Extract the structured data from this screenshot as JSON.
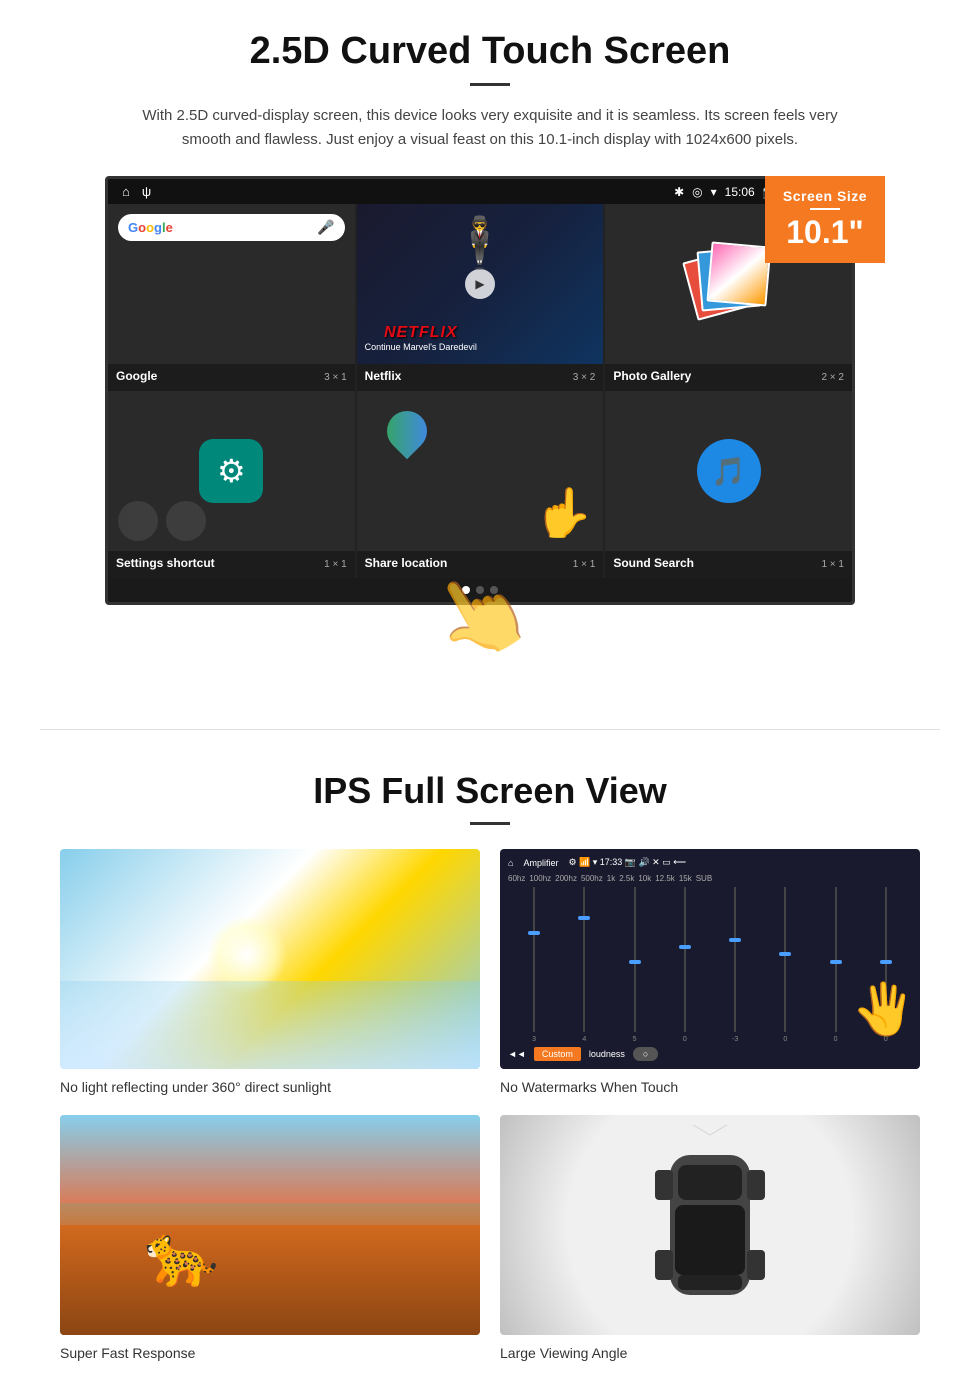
{
  "section1": {
    "title": "2.5D Curved Touch Screen",
    "description": "With 2.5D curved-display screen, this device looks very exquisite and it is seamless. Its screen feels very smooth and flawless. Just enjoy a visual feast on this 10.1-inch display with 1024x600 pixels.",
    "screen_badge": {
      "title": "Screen Size",
      "size": "10.1\""
    },
    "status_bar": {
      "time": "15:06"
    },
    "apps": {
      "row1": [
        {
          "name": "Google",
          "size": "3 × 1"
        },
        {
          "name": "Netflix",
          "size": "3 × 2"
        },
        {
          "name": "Photo Gallery",
          "size": "2 × 2"
        }
      ],
      "row2": [
        {
          "name": "Settings shortcut",
          "size": "1 × 1"
        },
        {
          "name": "Share location",
          "size": "1 × 1"
        },
        {
          "name": "Sound Search",
          "size": "1 × 1"
        }
      ]
    },
    "netflix_text": "NETFLIX",
    "netflix_subtitle": "Continue Marvel's Daredevil"
  },
  "section2": {
    "title": "IPS Full Screen View",
    "features": [
      {
        "id": "sunlight",
        "caption": "No light reflecting under 360° direct sunlight"
      },
      {
        "id": "equalizer",
        "caption": "No Watermarks When Touch"
      },
      {
        "id": "cheetah",
        "caption": "Super Fast Response"
      },
      {
        "id": "car",
        "caption": "Large Viewing Angle"
      }
    ]
  }
}
